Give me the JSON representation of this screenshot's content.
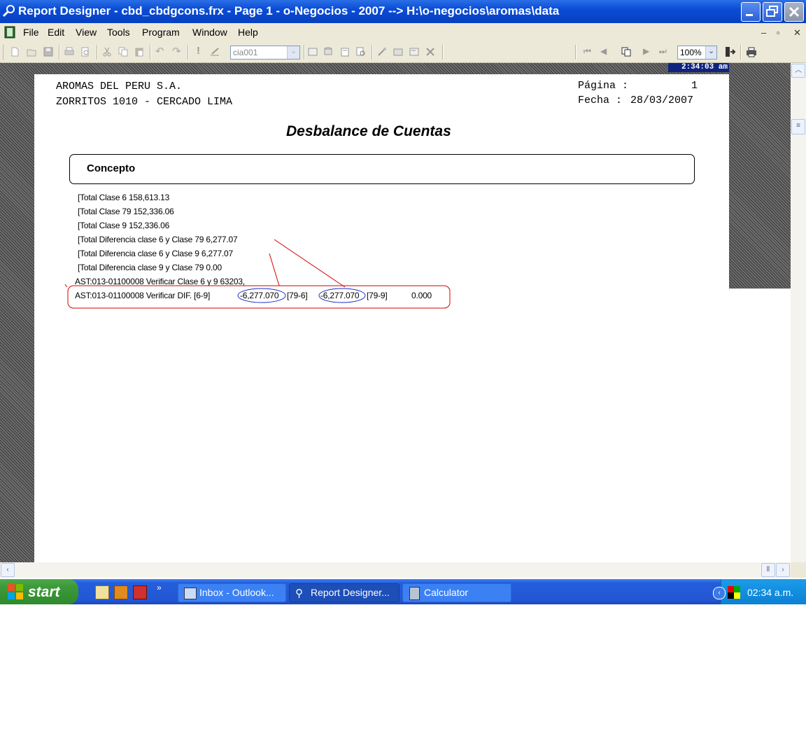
{
  "window": {
    "title": "Report Designer - cbd_cbdgcons.frx - Page 1 - o-Negocios - 2007 --> H:\\o-negocios\\aromas\\data"
  },
  "menu": {
    "items": [
      "File",
      "Edit",
      "View",
      "Tools",
      "Program",
      "Window",
      "Help"
    ]
  },
  "toolbar": {
    "company_combo": "cia001",
    "zoom_combo": "100%"
  },
  "preview": {
    "clock": "2:34:03 am"
  },
  "report": {
    "company_name": "AROMAS DEL PERU S.A.",
    "company_address": "ZORRITOS 1010 - CERCADO LIMA",
    "page_label": "Página :",
    "page_number": "1",
    "date_label": "Fecha :",
    "date_value": "28/03/2007",
    "title": "Desbalance de Cuentas",
    "column_header": "Concepto",
    "lines": [
      "[Total Clase 6     158,613.13",
      "[Total Clase 79     152,336.06",
      "[Total Clase 9     152,336.06",
      "[Total Diferencia clase 6 y Clase 79       6,277.07",
      "[Total Diferencia clase 6 y Clase 9      6,277.07",
      "[Total Diferencia clase 9 y Clase 79         0.00",
      "AST:013-01100008 Verificar Clase 6 y 9 63203,"
    ],
    "highlight_line": {
      "prefix": "AST:013-01100008 Verificar DIF. [6-9]",
      "value_a": "-6,277.070",
      "label_a": "[79-6]",
      "value_b": "-6,277.070",
      "label_b": "[79-9]",
      "value_c": "0.000"
    }
  },
  "taskbar": {
    "start_label": "start",
    "tasks": [
      "Inbox - Outlook...",
      "Report Designer...",
      "Calculator"
    ],
    "time": "02:34 a.m."
  },
  "colors": {
    "titlebar": "#0a4cd6",
    "annotation_red": "#d40000",
    "annotation_blue": "#1a2ec8"
  }
}
